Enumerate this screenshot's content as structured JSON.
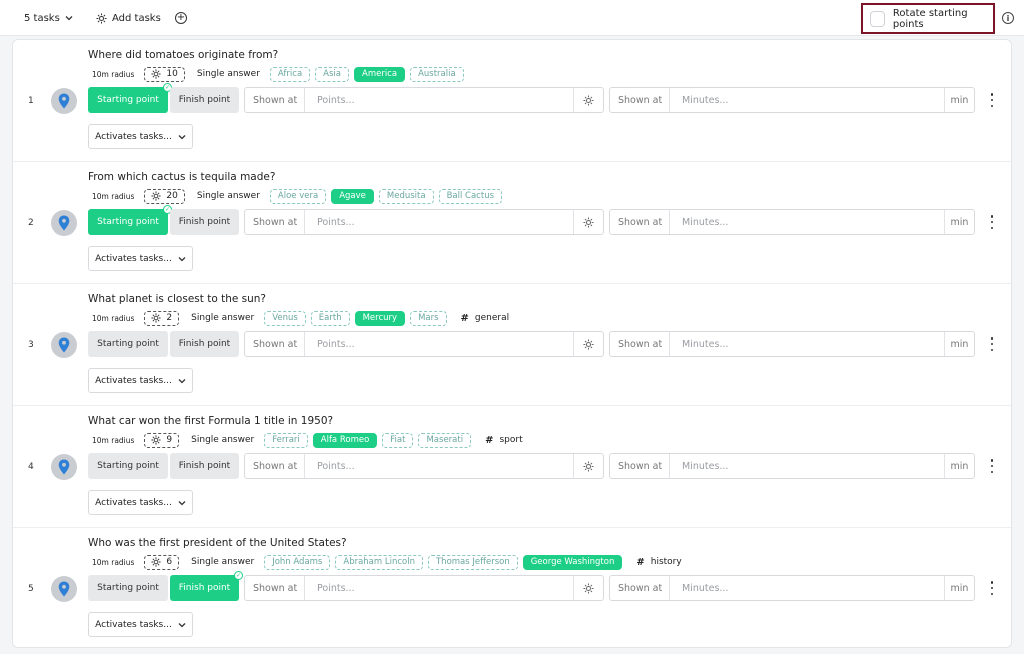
{
  "topbar": {
    "tasks_label": "5 tasks",
    "add_tasks_label": "Add tasks",
    "rotate_label": "Rotate starting points",
    "rotate_checked": false
  },
  "common": {
    "radius": "10m radius",
    "starting_point": "Starting point",
    "finish_point": "Finish point",
    "shown_at": "Shown at",
    "points_placeholder": "Points...",
    "minutes_placeholder": "Minutes...",
    "min_unit": "min",
    "activates": "Activates tasks..."
  },
  "colors": {
    "accent": "#1dcf86",
    "highlight": "#7a1426",
    "answer_outline": "#8ac8c0",
    "pin": "#2e7fd6"
  },
  "tasks": [
    {
      "number": "1",
      "question": "Where did tomatoes originate from?",
      "points": "10",
      "answer_type": "Single answer",
      "answers": [
        {
          "text": "Africa",
          "correct": false
        },
        {
          "text": "Asia",
          "correct": false
        },
        {
          "text": "America",
          "correct": true
        },
        {
          "text": "Australia",
          "correct": false
        }
      ],
      "tag": "",
      "active_point": "start"
    },
    {
      "number": "2",
      "question": "From which cactus is tequila made?",
      "points": "20",
      "answer_type": "Single answer",
      "answers": [
        {
          "text": "Aloe vera",
          "correct": false
        },
        {
          "text": "Agave",
          "correct": true
        },
        {
          "text": "Medusita",
          "correct": false
        },
        {
          "text": "Ball Cactus",
          "correct": false
        }
      ],
      "tag": "",
      "active_point": "start"
    },
    {
      "number": "3",
      "question": "What planet is closest to the sun?",
      "points": "2",
      "answer_type": "Single answer",
      "answers": [
        {
          "text": "Venus",
          "correct": false
        },
        {
          "text": "Earth",
          "correct": false
        },
        {
          "text": "Mercury",
          "correct": true
        },
        {
          "text": "Mars",
          "correct": false
        }
      ],
      "tag": "general",
      "active_point": ""
    },
    {
      "number": "4",
      "question": "What car won the first Formula 1 title in 1950?",
      "points": "9",
      "answer_type": "Single answer",
      "answers": [
        {
          "text": "Ferrari",
          "correct": false
        },
        {
          "text": "Alfa Romeo",
          "correct": true
        },
        {
          "text": "Fiat",
          "correct": false
        },
        {
          "text": "Maserati",
          "correct": false
        }
      ],
      "tag": "sport",
      "active_point": ""
    },
    {
      "number": "5",
      "question": "Who was the first president of the United States?",
      "points": "6",
      "answer_type": "Single answer",
      "answers": [
        {
          "text": "John Adams",
          "correct": false
        },
        {
          "text": "Abraham Lincoln",
          "correct": false
        },
        {
          "text": "Thomas Jefferson",
          "correct": false
        },
        {
          "text": "George Washington",
          "correct": true
        }
      ],
      "tag": "history",
      "active_point": "finish"
    }
  ]
}
